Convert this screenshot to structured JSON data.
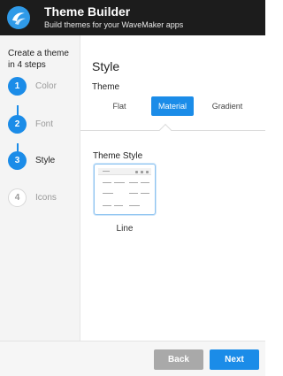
{
  "header": {
    "title": "Theme Builder",
    "subtitle": "Build themes for your WaveMaker apps",
    "logo_icon": "wavemaker-logo-icon",
    "background": "#1c1c1c"
  },
  "sidebar": {
    "heading": "Create a theme in 4 steps",
    "steps": [
      {
        "number": "1",
        "label": "Color",
        "state": "done"
      },
      {
        "number": "2",
        "label": "Font",
        "state": "done"
      },
      {
        "number": "3",
        "label": "Style",
        "state": "current"
      },
      {
        "number": "4",
        "label": "Icons",
        "state": "pending"
      }
    ]
  },
  "main": {
    "title": "Style",
    "theme_label": "Theme",
    "tabs": [
      {
        "label": "Flat",
        "selected": false
      },
      {
        "label": "Material",
        "selected": true
      },
      {
        "label": "Gradient",
        "selected": false
      }
    ],
    "theme_style_label": "Theme Style",
    "style_options": [
      {
        "label": "Line",
        "selected": true
      }
    ]
  },
  "footer": {
    "back_label": "Back",
    "next_label": "Next"
  },
  "colors": {
    "accent": "#1b8ce8",
    "back_button": "#a9a9a9"
  }
}
